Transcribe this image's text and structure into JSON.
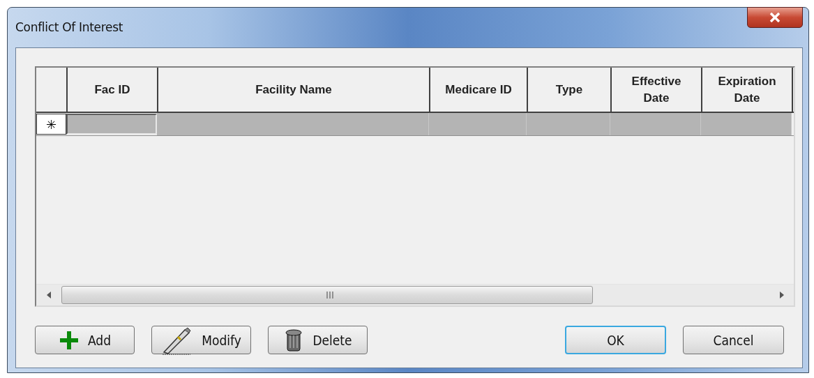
{
  "window": {
    "title": "Conflict Of Interest"
  },
  "table": {
    "columns": [
      {
        "label": "Fac ID",
        "current": true
      },
      {
        "label": "Facility Name",
        "current": false
      },
      {
        "label": "Medicare ID",
        "current": false
      },
      {
        "label": "Type",
        "current": false
      },
      {
        "label": "Effective Date",
        "current": false
      },
      {
        "label": "Expiration Date",
        "current": false
      }
    ],
    "new_row_marker": "✳"
  },
  "left_buttons": [
    {
      "kind": "add",
      "label": "Add"
    },
    {
      "kind": "modify",
      "label": "Modify"
    },
    {
      "kind": "delete",
      "label": "Delete"
    }
  ],
  "right_buttons": [
    {
      "label": "OK",
      "focused": true
    },
    {
      "label": "Cancel",
      "focused": false
    }
  ]
}
